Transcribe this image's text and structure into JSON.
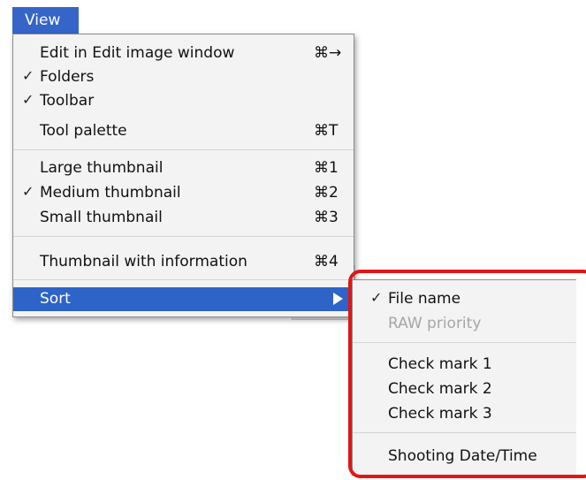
{
  "menubar": {
    "title": "View"
  },
  "view_menu": {
    "items": [
      {
        "label": "Edit in Edit image window",
        "shortcut": "⌘→",
        "checked": false
      },
      {
        "label": "Folders",
        "shortcut": "",
        "checked": true
      },
      {
        "label": "Toolbar",
        "shortcut": "",
        "checked": true
      },
      {
        "label": "Tool palette",
        "shortcut": "⌘T",
        "checked": false
      },
      {
        "label": "Large thumbnail",
        "shortcut": "⌘1",
        "checked": false
      },
      {
        "label": "Medium thumbnail",
        "shortcut": "⌘2",
        "checked": true
      },
      {
        "label": "Small thumbnail",
        "shortcut": "⌘3",
        "checked": false
      },
      {
        "label": "Thumbnail with information",
        "shortcut": "⌘4",
        "checked": false
      },
      {
        "label": "Sort",
        "shortcut": "",
        "checked": false,
        "submenu": true,
        "selected": true
      }
    ]
  },
  "sort_submenu": {
    "items": [
      {
        "label": "File name",
        "checked": true,
        "disabled": false
      },
      {
        "label": "RAW priority",
        "checked": false,
        "disabled": true
      },
      {
        "label": "Check mark 1",
        "checked": false,
        "disabled": false
      },
      {
        "label": "Check mark 2",
        "checked": false,
        "disabled": false
      },
      {
        "label": "Check mark 3",
        "checked": false,
        "disabled": false
      },
      {
        "label": "Shooting Date/Time",
        "checked": false,
        "disabled": false
      }
    ]
  },
  "glyphs": {
    "checkmark": "✓"
  },
  "colors": {
    "selection": "#2e63c7",
    "menu_bg": "#f3f3f3",
    "highlight_box": "#e11616",
    "disabled_text": "#a6a6a6"
  }
}
